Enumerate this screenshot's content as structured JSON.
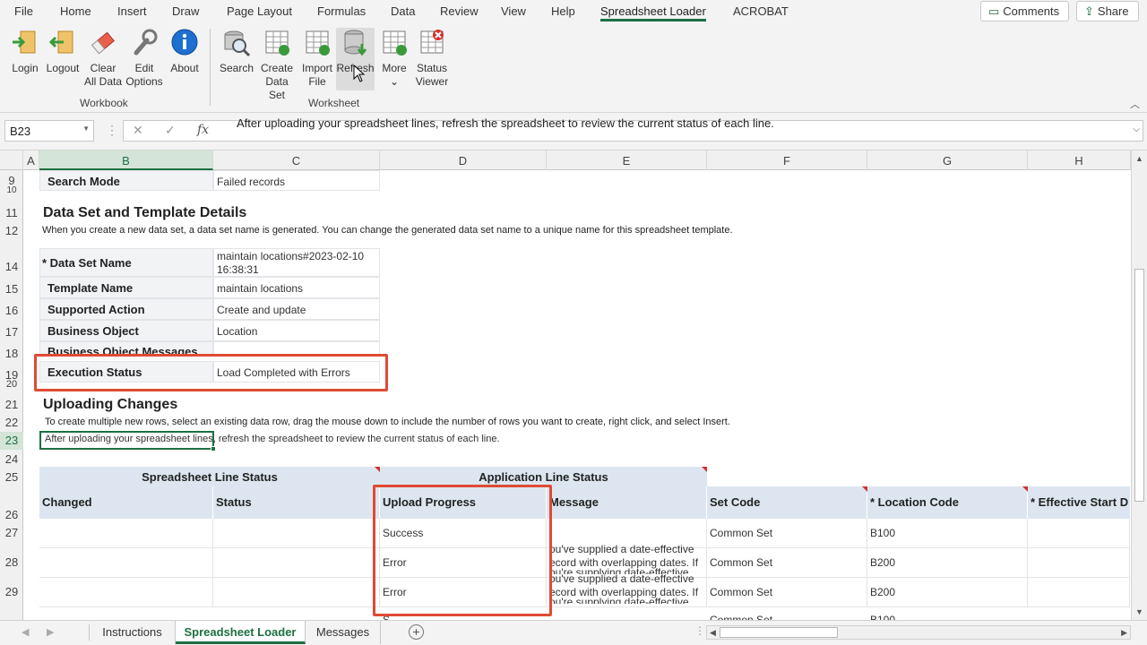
{
  "menu": {
    "items": [
      "File",
      "Home",
      "Insert",
      "Draw",
      "Page Layout",
      "Formulas",
      "Data",
      "Review",
      "View",
      "Help",
      "Spreadsheet Loader",
      "ACROBAT"
    ],
    "active": "Spreadsheet Loader",
    "comments": "Comments",
    "share": "Share"
  },
  "ribbon": {
    "workbook_buttons": [
      {
        "label1": "Login",
        "label2": ""
      },
      {
        "label1": "Logout",
        "label2": ""
      },
      {
        "label1": "Clear",
        "label2": "All Data"
      },
      {
        "label1": "Edit",
        "label2": "Options"
      },
      {
        "label1": "About",
        "label2": ""
      }
    ],
    "worksheet_buttons": [
      {
        "label1": "Search",
        "label2": ""
      },
      {
        "label1": "Create",
        "label2": "Data Set"
      },
      {
        "label1": "Import",
        "label2": "File"
      },
      {
        "label1": "Refresh",
        "label2": ""
      },
      {
        "label1": "More",
        "label2": "⌄"
      },
      {
        "label1": "Status",
        "label2": "Viewer"
      }
    ],
    "group_workbook": "Workbook",
    "group_worksheet": "Worksheet"
  },
  "formula_bar": {
    "cell_ref": "B23",
    "fx": "fx",
    "content": "After uploading your spreadsheet lines, refresh the spreadsheet to review the current status of each line."
  },
  "columns": [
    "A",
    "B",
    "C",
    "D",
    "E",
    "F",
    "G",
    "H"
  ],
  "rows": [
    "9",
    "10",
    "11",
    "12",
    "14",
    "15",
    "16",
    "17",
    "18",
    "19",
    "20",
    "21",
    "22",
    "23",
    "24",
    "25",
    "26",
    "27",
    "28",
    "29"
  ],
  "sheet": {
    "search_mode_label": "Search Mode",
    "search_mode_value": "Failed records",
    "ds_title": "Data Set and Template Details",
    "ds_hint": "When you create a new data set, a data set name is generated. You can change the generated data set name to a unique name for this spreadsheet template.",
    "details": [
      {
        "label": "* Data Set Name",
        "value": "maintain locations#2023-02-10",
        "value2": "16:38:31"
      },
      {
        "label": "Template Name",
        "value": "maintain locations",
        "value2": ""
      },
      {
        "label": "Supported Action",
        "value": "Create and update",
        "value2": ""
      },
      {
        "label": "Business Object",
        "value": "Location",
        "value2": ""
      },
      {
        "label": "Business Object Messages",
        "value": "",
        "value2": ""
      },
      {
        "label": "Execution Status",
        "value": "Load Completed with Errors",
        "value2": ""
      }
    ],
    "upload_title": "Uploading Changes",
    "upload_hint": "To create multiple new rows, select an existing data row, drag the mouse down to include the number of rows you want to create, right click, and select Insert.",
    "b23_text": "After uploading your spreadsheet lines, refresh the spreadsheet to review the current status of each line.",
    "group_headers": [
      "Spreadsheet Line Status",
      "Application Line Status"
    ],
    "table_headers": [
      "Changed",
      "Status",
      "Upload Progress",
      "Message",
      "Set Code",
      "* Location Code",
      "* Effective Start D"
    ],
    "table_rows": [
      {
        "changed": "",
        "status": "",
        "progress": "Success",
        "msg1": "",
        "msg2": "",
        "set_code": "Common Set",
        "loc": "B100"
      },
      {
        "changed": "",
        "status": "",
        "progress": "Error",
        "msg1": "ou've supplied a date-effective",
        "msg2": "ecord with overlapping dates. If",
        "set_code": "Common Set",
        "loc": "B200"
      },
      {
        "changed": "",
        "status": "",
        "progress": "Error",
        "msg1": "ou've supplied a date-effective",
        "msg2": "ecord with overlapping dates. If",
        "set_code": "Common Set",
        "loc": "B200"
      }
    ],
    "row28_overlap": "ou're supplying date-effective",
    "row29_overlap": "ou're supplying date-effective",
    "row30_partial": [
      "S",
      "Common Set",
      "B100"
    ]
  },
  "sheet_tabs": [
    "Instructions",
    "Spreadsheet Loader",
    "Messages"
  ],
  "active_tab": "Spreadsheet Loader",
  "colors": {
    "accent": "#1d6f42",
    "callout": "#e04a34",
    "header_blue": "#dde6f0"
  }
}
